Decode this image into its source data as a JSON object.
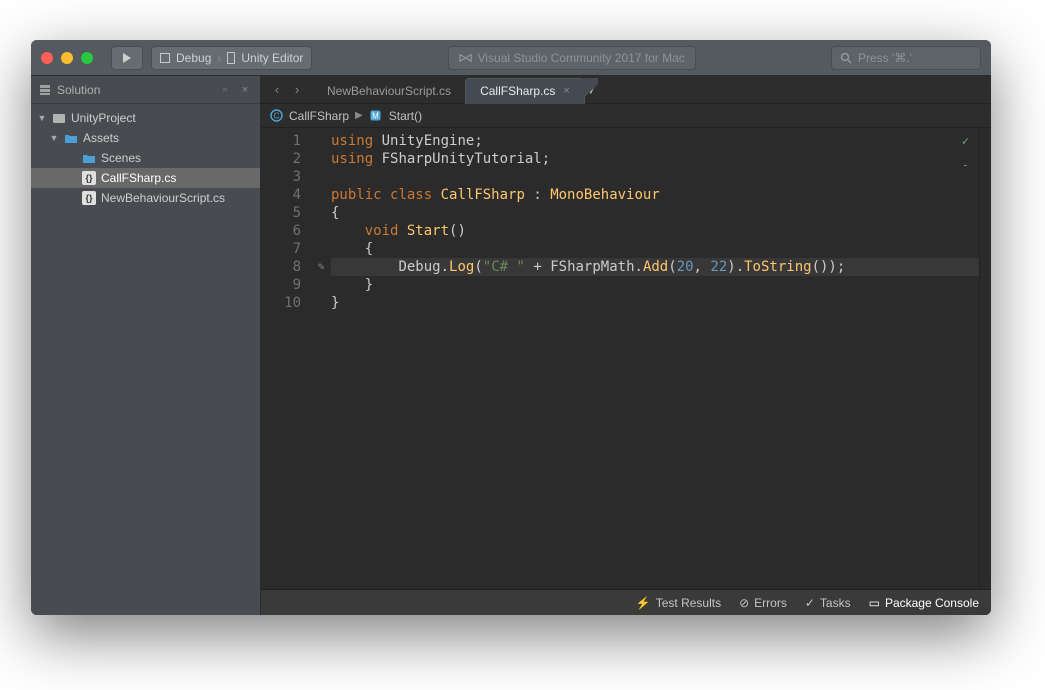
{
  "toolbar": {
    "config_label": "Debug",
    "target_label": "Unity Editor",
    "center_text": "Visual Studio Community 2017 for Mac",
    "search_placeholder": "Press '⌘.'"
  },
  "solution_panel": {
    "title": "Solution",
    "tree": {
      "root": "UnityProject",
      "assets": "Assets",
      "scenes": "Scenes",
      "file1": "CallFSharp.cs",
      "file2": "NewBehaviourScript.cs"
    }
  },
  "tabs": {
    "tab0": "NewBehaviourScript.cs",
    "tab1": "CallFSharp.cs"
  },
  "breadcrumb": {
    "class": "CallFSharp",
    "method": "Start()"
  },
  "code": {
    "line_count": 10,
    "lines": {
      "l1": {
        "keyword": "using",
        "ident": "UnityEngine"
      },
      "l2": {
        "keyword": "using",
        "ident": "FSharpUnityTutorial"
      },
      "l4_public": "public",
      "l4_class": "class",
      "l4_name": "CallFSharp",
      "l4_base": "MonoBehaviour",
      "l6_void": "void",
      "l6_name": "Start",
      "l8_debug": "Debug",
      "l8_log": "Log",
      "l8_str": "\"C# \"",
      "l8_fsm": "FSharpMath",
      "l8_add": "Add",
      "l8_arg1": "20",
      "l8_arg2": "22",
      "l8_tostr": "ToString"
    }
  },
  "status": {
    "test_results": "Test Results",
    "errors": "Errors",
    "tasks": "Tasks",
    "package_console": "Package Console"
  }
}
